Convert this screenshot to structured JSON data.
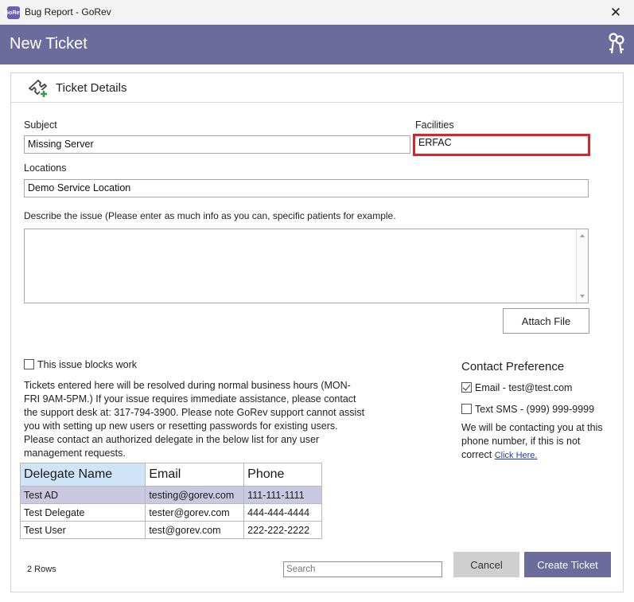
{
  "window": {
    "title": "Bug Report - GoRev",
    "app_icon": "GoRev",
    "close_glyph": "✕"
  },
  "header": {
    "title": "New Ticket",
    "icon": "keys-icon"
  },
  "panel": {
    "title": "Ticket Details",
    "icon": "ticket-add-icon"
  },
  "form": {
    "subject_label": "Subject",
    "subject_value": "Missing Server",
    "facilities_label": "Facilities",
    "facilities_value": "ERFAC",
    "locations_label": "Locations",
    "locations_value": "Demo Service Location",
    "describe_label": "Describe the issue (Please enter as much info as you can, specific patients for example.",
    "describe_value": "",
    "attach_label": "Attach File",
    "blocks_label": "This issue blocks work",
    "blocks_checked": false
  },
  "info_text": "Tickets entered here will be resolved during normal business hours (MON-FRI 9AM-5PM.) If your issue requires immediate assistance, please contact the support desk at: 317-794-3900.  Please note GoRev support cannot assist you with setting up new users or resetting passwords for existing users.  Please contact an authorized delegate in the below list for any user management requests.",
  "contact": {
    "title": "Contact Preference",
    "email_label": "Email - test@test.com",
    "email_checked": true,
    "sms_label": "Text SMS - (999) 999-9999",
    "sms_checked": false,
    "note": "We will be contacting you at this phone number, if this is not correct",
    "link": "Click Here."
  },
  "delegates": {
    "headers": [
      "Delegate Name",
      "Email",
      "Phone"
    ],
    "rows": [
      [
        "Test AD",
        "testing@gorev.com",
        "111-111-1111"
      ],
      [
        "Test Delegate",
        "tester@gorev.com",
        "444-444-4444"
      ],
      [
        "Test User",
        "test@gorev.com",
        "222-222-2222"
      ]
    ],
    "row_count": "2 Rows",
    "search_placeholder": "Search"
  },
  "buttons": {
    "cancel": "Cancel",
    "create": "Create Ticket"
  },
  "colors": {
    "accent": "#6b6c9c",
    "highlight": "#e0202a",
    "selected_row": "#c8c8e0",
    "sorted_header": "#cfe5f7"
  }
}
